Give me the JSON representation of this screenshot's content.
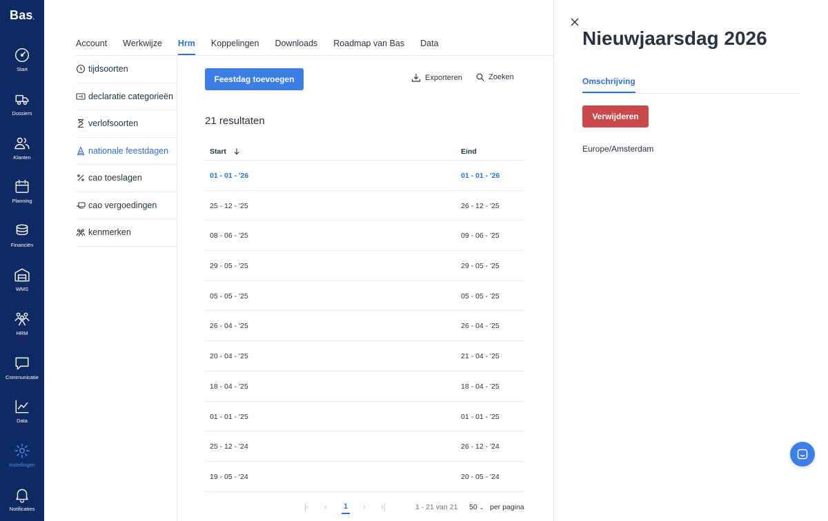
{
  "brand": {
    "logo": "Bas",
    "logo_mark": "."
  },
  "nav": [
    {
      "label": "Start",
      "icon": "dashboard-icon"
    },
    {
      "label": "Dossiers",
      "icon": "truck-icon"
    },
    {
      "label": "Klanten",
      "icon": "users-icon"
    },
    {
      "label": "Planning",
      "icon": "calendar-icon"
    },
    {
      "label": "Financiën",
      "icon": "coins-icon"
    },
    {
      "label": "WMS",
      "icon": "warehouse-icon"
    },
    {
      "label": "HRM",
      "icon": "team-icon"
    },
    {
      "label": "Communicatie",
      "icon": "chat-bubble-icon"
    },
    {
      "label": "Data",
      "icon": "line-chart-icon"
    },
    {
      "label": "Instellingen",
      "icon": "gear-icon"
    },
    {
      "label": "Notificaties",
      "icon": "bell-icon"
    }
  ],
  "tabs": [
    "Account",
    "Werkwijze",
    "Hrm",
    "Koppelingen",
    "Downloads",
    "Roadmap van Bas",
    "Data"
  ],
  "active_tab": "Hrm",
  "subnav": [
    {
      "label": "tijdsoorten",
      "icon": "clock-icon"
    },
    {
      "label": "declaratie categorieën",
      "icon": "receipt-icon"
    },
    {
      "label": "verlofsoorten",
      "icon": "hourglass-icon"
    },
    {
      "label": "nationale feestdagen",
      "icon": "party-hat-icon"
    },
    {
      "label": "cao toeslagen",
      "icon": "percent-icon"
    },
    {
      "label": "cao vergoedingen",
      "icon": "money-hand-icon"
    },
    {
      "label": "kenmerken",
      "icon": "people-group-icon"
    }
  ],
  "toolbar": {
    "add_label": "Feestdag toevoegen",
    "export_label": "Exporteren",
    "search_label": "Zoeken"
  },
  "results_label": "21 resultaten",
  "table": {
    "col_start": "Start",
    "col_end": "Eind",
    "rows": [
      {
        "start": "01 - 01 - '26",
        "end": "01 - 01 - '26"
      },
      {
        "start": "25 - 12 - '25",
        "end": "26 - 12 - '25"
      },
      {
        "start": "08 - 06 - '25",
        "end": "09 - 06 - '25"
      },
      {
        "start": "29 - 05 - '25",
        "end": "29 - 05 - '25"
      },
      {
        "start": "05 - 05 - '25",
        "end": "05 - 05 - '25"
      },
      {
        "start": "26 - 04 - '25",
        "end": "26 - 04 - '25"
      },
      {
        "start": "20 - 04 - '25",
        "end": "21 - 04 - '25"
      },
      {
        "start": "18 - 04 - '25",
        "end": "18 - 04 - '25"
      },
      {
        "start": "01 - 01 - '25",
        "end": "01 - 01 - '25"
      },
      {
        "start": "25 - 12 - '24",
        "end": "26 - 12 - '24"
      },
      {
        "start": "19 - 05 - '24",
        "end": "20 - 05 - '24"
      }
    ]
  },
  "pagination": {
    "current": "1",
    "range": "1 - 21 van 21",
    "per_page": "50",
    "per_page_label": "per pagina"
  },
  "panel": {
    "title": "Nieuwjaarsdag 2026",
    "tab": "Omschrijving",
    "delete_label": "Verwijderen",
    "timezone": "Europe/Amsterdam"
  },
  "colors": {
    "nav_bg": "#0d2a63",
    "accent": "#3c7ee8",
    "danger": "#c8494b"
  }
}
